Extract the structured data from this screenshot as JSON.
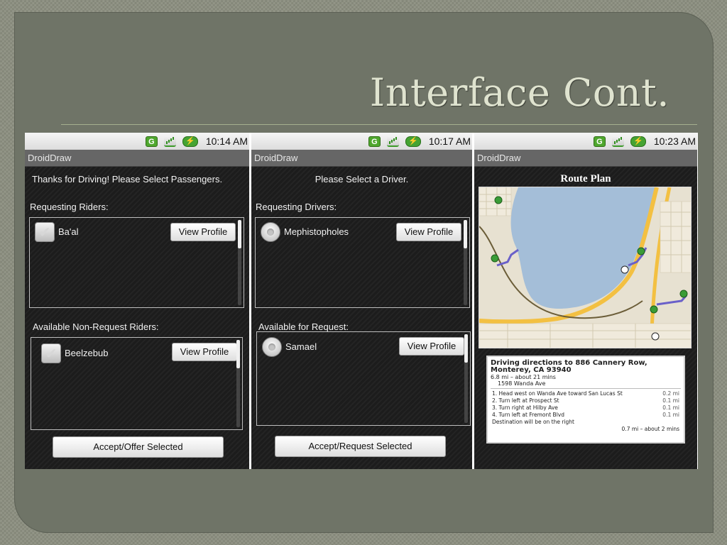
{
  "slide": {
    "title": "Interface Cont."
  },
  "screens": [
    {
      "status": {
        "net": "G",
        "time": "10:14 AM"
      },
      "app_title": "DroidDraw",
      "prompt": "Thanks for Driving! Please Select Passengers.",
      "list1_label": "Requesting Riders:",
      "list1_items": [
        {
          "name": "Ba'al",
          "button": "View Profile"
        }
      ],
      "list2_label": "Available Non-Request Riders:",
      "list2_items": [
        {
          "name": "Beelzebub",
          "button": "View Profile"
        }
      ],
      "action_button": "Accept/Offer Selected"
    },
    {
      "status": {
        "net": "G",
        "time": "10:17 AM"
      },
      "app_title": "DroidDraw",
      "prompt": "Please Select a Driver.",
      "list1_label": "Requesting Drivers:",
      "list1_items": [
        {
          "name": "Mephistopholes",
          "button": "View Profile"
        }
      ],
      "list2_label": "Available for Request:",
      "list2_items": [
        {
          "name": "Samael",
          "button": "View Profile"
        }
      ],
      "action_button": "Accept/Request Selected"
    },
    {
      "status": {
        "net": "G",
        "time": "10:23 AM"
      },
      "app_title": "DroidDraw",
      "heading": "Route Plan",
      "directions": {
        "header": "Driving directions to 886 Cannery Row, Monterey, CA 93940",
        "summary": "6.8 mi – about 21 mins",
        "start": "1598 Wanda Ave",
        "steps": [
          {
            "n": "1.",
            "text": "Head west on Wanda Ave toward San Lucas St",
            "dist": "0.2 mi"
          },
          {
            "n": "2.",
            "text": "Turn left at Prospect St",
            "dist": "0.1 mi"
          },
          {
            "n": "3.",
            "text": "Turn right at Hilby Ave",
            "dist": "0.1 mi"
          },
          {
            "n": "4.",
            "text": "Turn left at Fremont Blvd",
            "dist": "0.1 mi"
          }
        ],
        "destination_note": "Destination will be on the right",
        "footer": "0.7 mi – about 2 mins"
      }
    }
  ]
}
